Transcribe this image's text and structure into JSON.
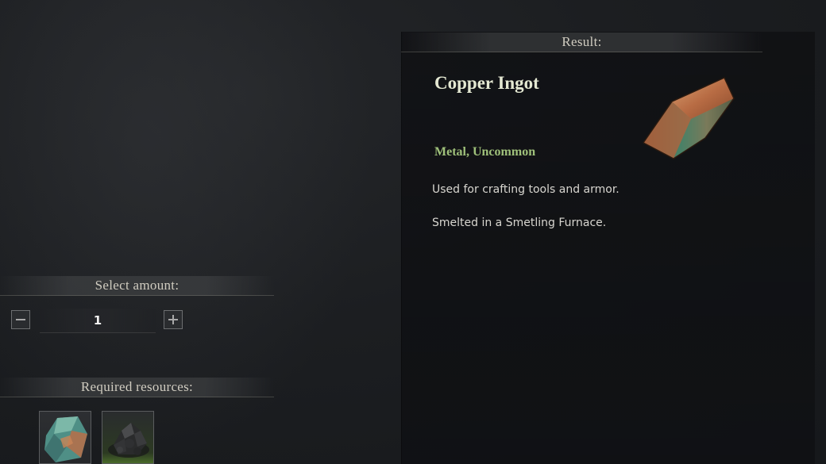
{
  "result": {
    "header": "Result:",
    "item_name": "Copper Ingot",
    "category": "Metal, Uncommon",
    "description_1": "Used for crafting tools and armor.",
    "description_2": "Smelted in a Smetling Furnace.",
    "icon": "copper-ingot-icon"
  },
  "amount": {
    "header": "Select amount:",
    "value": "1",
    "minus_icon": "minus-icon",
    "plus_icon": "plus-icon"
  },
  "resources": {
    "header": "Required resources:",
    "items": [
      {
        "icon": "copper-ore-icon"
      },
      {
        "icon": "coal-icon"
      }
    ]
  },
  "colors": {
    "item_name": "#e4e8d2",
    "category": "#9fc07a",
    "background": "#1c1e21"
  }
}
